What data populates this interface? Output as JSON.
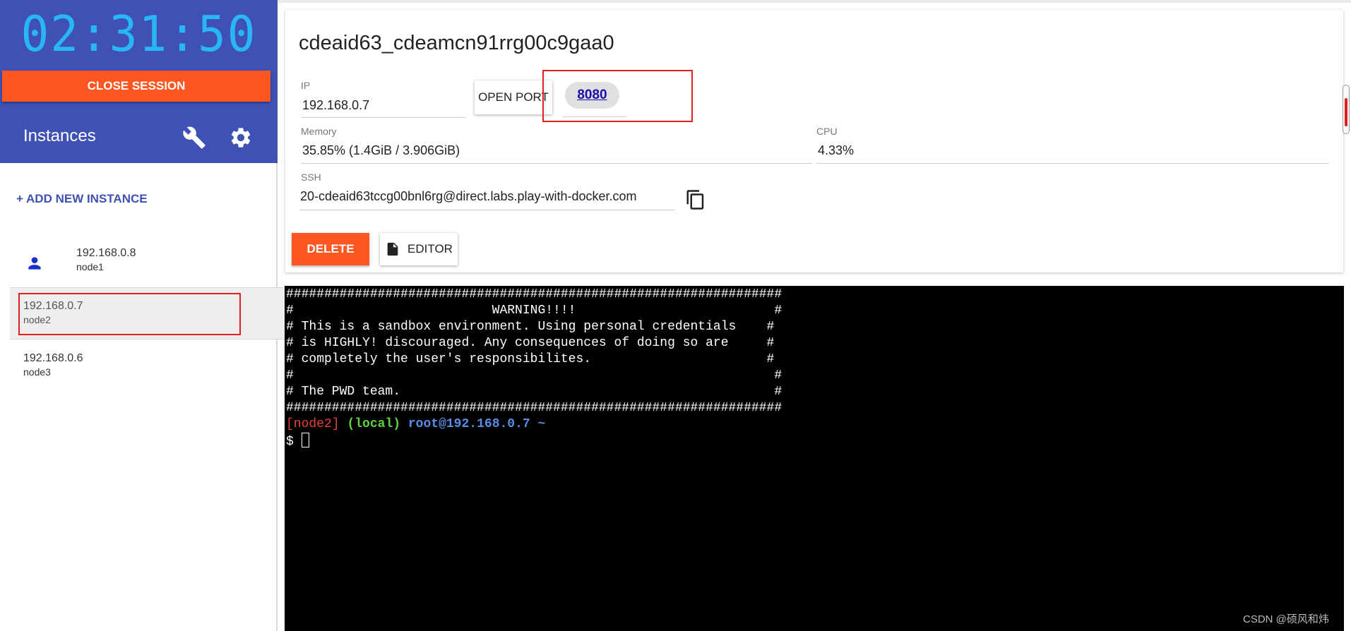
{
  "session": {
    "timer": "02:31:50",
    "close_label": "CLOSE SESSION"
  },
  "sidebar": {
    "title": "Instances",
    "add_label": "+ ADD NEW INSTANCE",
    "instances": [
      {
        "ip": "192.168.0.8",
        "name": "node1"
      },
      {
        "ip": "192.168.0.7",
        "name": "node2"
      },
      {
        "ip": "192.168.0.6",
        "name": "node3"
      }
    ]
  },
  "instance": {
    "title": "cdeaid63_cdeamcn91rrg00c9gaa0",
    "ip_label": "IP",
    "ip_value": "192.168.0.7",
    "open_port_label": "OPEN PORT",
    "port": "8080",
    "memory_label": "Memory",
    "memory_value": "35.85% (1.4GiB / 3.906GiB)",
    "cpu_label": "CPU",
    "cpu_value": "4.33%",
    "ssh_label": "SSH",
    "ssh_value": "20-cdeaid63tccg00bnl6rg@direct.labs.play-with-docker.com",
    "delete_label": "DELETE",
    "editor_label": "EDITOR"
  },
  "terminal": {
    "lines": [
      "#################################################################",
      "#                          WARNING!!!!                          #",
      "# This is a sandbox environment. Using personal credentials    #",
      "# is HIGHLY! discouraged. Any consequences of doing so are     #",
      "# completely the user's responsibilites.                       #",
      "#                                                               #",
      "# The PWD team.                                                 #",
      "#################################################################"
    ],
    "prompt_node": "[node2]",
    "prompt_local": "(local)",
    "prompt_host": "root@192.168.0.7 ~",
    "prompt_symbol": "$ "
  },
  "watermark": "CSDN @硕风和炜",
  "colors": {
    "sidebar_bg": "#3f51b5",
    "accent_orange": "#ff5722",
    "timer_blue": "#29b6f6",
    "highlight_red": "#e02020"
  },
  "icons": {
    "settings": "wrench-icon",
    "config": "gear-icon",
    "user": "person-icon",
    "copy": "copy-icon",
    "file": "file-icon"
  }
}
